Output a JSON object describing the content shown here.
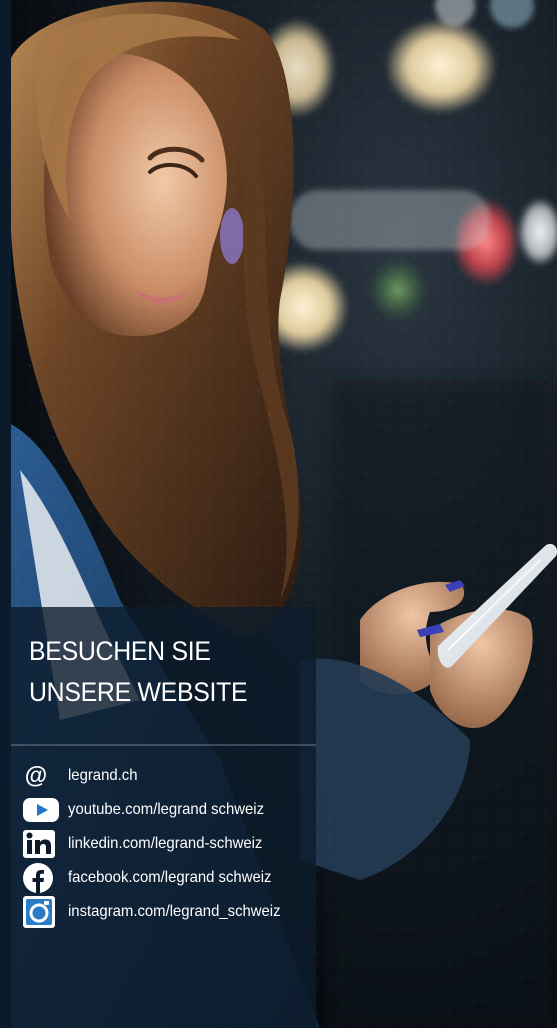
{
  "panel": {
    "title_lines": [
      "BESUCHEN SIE",
      "UNSERE WEBSITE"
    ]
  },
  "links": [
    {
      "icon": "at-icon",
      "label": "legrand.ch"
    },
    {
      "icon": "youtube-icon",
      "label": "youtube.com/legrand schweiz"
    },
    {
      "icon": "linkedin-icon",
      "label": "linkedin.com/legrand-schweiz"
    },
    {
      "icon": "facebook-icon",
      "label": "facebook.com/legrand schweiz"
    },
    {
      "icon": "instagram-icon",
      "label": "instagram.com/legrand_schweiz"
    }
  ],
  "colors": {
    "panel_background": "#0c1b2c",
    "text": "#ffffff",
    "youtube_play": "#1f78c8",
    "instagram_tile": "#2a7cc7"
  }
}
